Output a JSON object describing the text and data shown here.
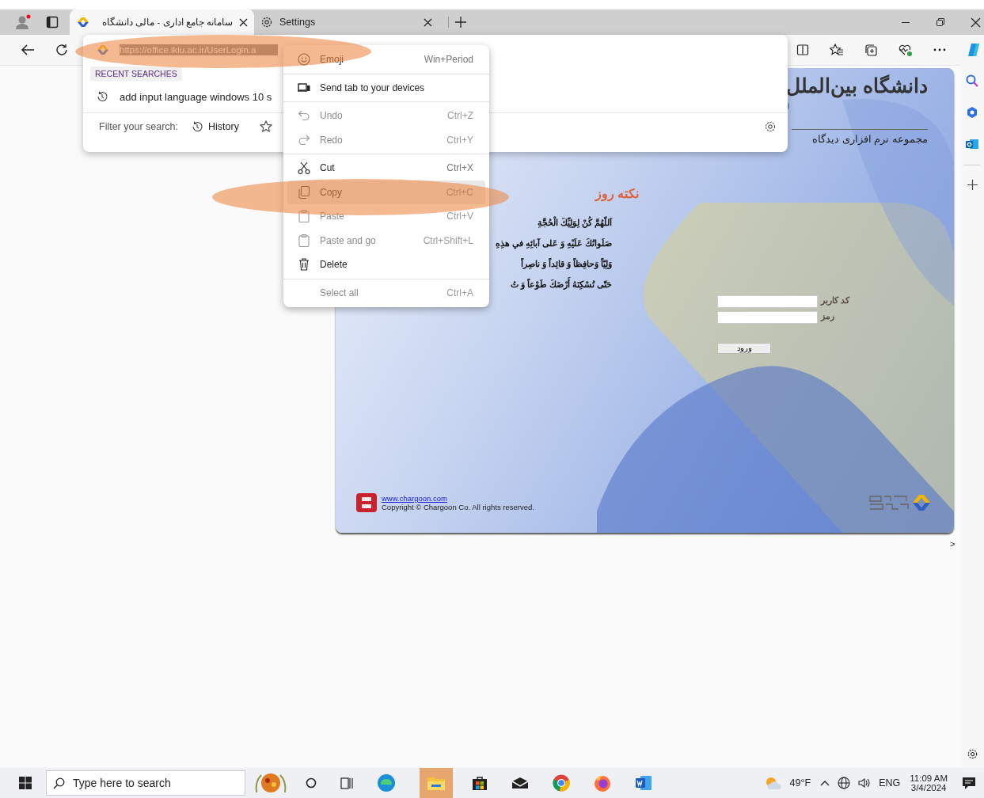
{
  "tabs": [
    {
      "title": "سامانه جامع اداری - مالی دانشگاه",
      "selected": true
    },
    {
      "title": "Settings",
      "selected": false
    }
  ],
  "address_popup": {
    "url": "https://office.ikiu.ac.ir/UserLogin.a",
    "recent_heading": "RECENT SEARCHES",
    "recent_items": [
      "add input language windows 10 s"
    ],
    "filter_label": "Filter your search:",
    "filter_options": [
      "History"
    ]
  },
  "context_menu": {
    "groups": [
      [
        {
          "label": "Emoji",
          "shortcut": "Win+Period",
          "disabled": false,
          "selected": false
        }
      ],
      [
        {
          "label": "Send tab to your devices",
          "disabled": false,
          "selected": false
        }
      ],
      [
        {
          "label": "Undo",
          "shortcut": "Ctrl+Z",
          "disabled": true,
          "selected": false
        },
        {
          "label": "Redo",
          "shortcut": "Ctrl+Y",
          "disabled": true,
          "selected": false
        }
      ],
      [
        {
          "label": "Cut",
          "shortcut": "Ctrl+X",
          "disabled": false,
          "selected": false
        },
        {
          "label": "Copy",
          "shortcut": "Ctrl+C",
          "disabled": false,
          "selected": true
        },
        {
          "label": "Paste",
          "shortcut": "Ctrl+V",
          "disabled": true,
          "selected": false
        },
        {
          "label": "Paste and go",
          "shortcut": "Ctrl+Shift+L",
          "disabled": true,
          "selected": false
        },
        {
          "label": "Delete",
          "disabled": false,
          "selected": false
        }
      ],
      [
        {
          "label": "Select all",
          "shortcut": "Ctrl+A",
          "disabled": true,
          "selected": false
        }
      ]
    ]
  },
  "page": {
    "title": "دانشگاه بین‌الملل",
    "subtitle": "مجموعه نرم افزاری دیدگاه",
    "tip_heading": "نکته روز",
    "tip_lines": [
      "اَللّهُمَّ كُنْ لِوَلِيِّكَ الْحُجَّةِ",
      "صَلَواتُكَ عَلَيْهِ وَ عَلى آبائِهِ في هذِهِ",
      "وَلِيّاً وَحافِظاً وَ قائِداً وَ ناصِراً",
      "حَتّى تُسْكِنَهُ أَرْضَكَ طَوْعاً وَ تُ"
    ],
    "login": {
      "fields": [
        {
          "label": "کد کاربر"
        },
        {
          "label": "رمز"
        }
      ],
      "button": "ورود"
    },
    "footer": {
      "link": "www.chargoon.com",
      "copyright": "Copyright © Chargoon Co. All rights reserved."
    },
    "scroll_arrow": ">"
  },
  "taskbar": {
    "search_placeholder": "Type here to search",
    "weather": "49°F",
    "language": "ENG",
    "time": "11:09 AM",
    "date": "3/4/2024"
  }
}
